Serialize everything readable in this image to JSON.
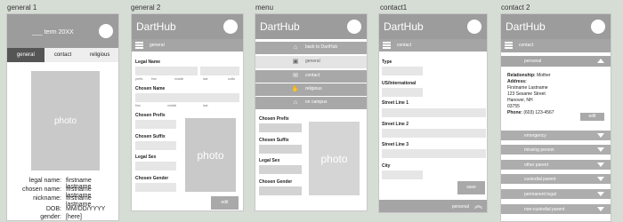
{
  "screens": {
    "general1": {
      "title": "general 1"
    },
    "general2": {
      "title": "general 2"
    },
    "menu": {
      "title": "menu"
    },
    "contact1": {
      "title": "contact1"
    },
    "contact2": {
      "title": "contact 2"
    }
  },
  "app": {
    "logo": "DartHub"
  },
  "general1": {
    "term": "___ term 20XX",
    "tabs": [
      "general",
      "contact",
      "religious"
    ],
    "photo": "photo",
    "info": [
      {
        "key": "legal name:",
        "value": "firstname lastname"
      },
      {
        "key": "chosen name:",
        "value": "firstname lastname"
      },
      {
        "key": "nickname:",
        "value": "firstname lastname"
      },
      {
        "key": "DOB:",
        "value": "MM/DD/YYYY"
      },
      {
        "key": "gender:",
        "value": "[here]"
      }
    ]
  },
  "general2": {
    "sub": "general",
    "legal_name": "Legal Name",
    "legal_parts": [
      "prefix",
      "first",
      "middle",
      "last",
      "suffix"
    ],
    "chosen_name": "Chosen Name",
    "chosen_parts": [
      "first",
      "middle",
      "last"
    ],
    "chosen_prefix": "Chosen Prefix",
    "chosen_suffix": "Chosen Suffix",
    "legal_sex": "Legal Sex",
    "chosen_gender": "Chosen Gender",
    "photo": "photo",
    "edit": "edit"
  },
  "menu": {
    "items": [
      {
        "label": "back to DartHub",
        "icon": "home-icon",
        "glyph": "⌂"
      },
      {
        "label": "general",
        "icon": "id-card-icon",
        "glyph": "▣"
      },
      {
        "label": "contact",
        "icon": "envelope-icon",
        "glyph": "✉"
      },
      {
        "label": "religious",
        "icon": "hands-icon",
        "glyph": "✋"
      },
      {
        "label": "on campus",
        "icon": "campus-icon",
        "glyph": "⌂"
      }
    ],
    "behind": [
      "Chosen Prefix",
      "Chosen Suffix",
      "Legal Sex",
      "Chosen Gender"
    ],
    "photo": "photo"
  },
  "contact1": {
    "sub": "contact",
    "fields": [
      "Type",
      "US/International",
      "Street Line 1",
      "Street Line 2",
      "Street Line 3",
      "City"
    ],
    "save": "save",
    "footer": "personal"
  },
  "contact2": {
    "sub": "contact",
    "open_section": "personal",
    "relationship_label": "Relationship:",
    "relationship_value": "Mother",
    "address_label": "Address:",
    "address_lines": [
      "Firstname Lastname",
      "123 Sesame Street",
      "Hanover, NH",
      "03755"
    ],
    "phone_label": "Phone:",
    "phone_value": "(603) 123-4567",
    "edit": "edit",
    "sections": [
      "emergency",
      "missing person",
      "other parent",
      "custodial parent",
      "permanent legal",
      "non-custodial parent"
    ]
  }
}
